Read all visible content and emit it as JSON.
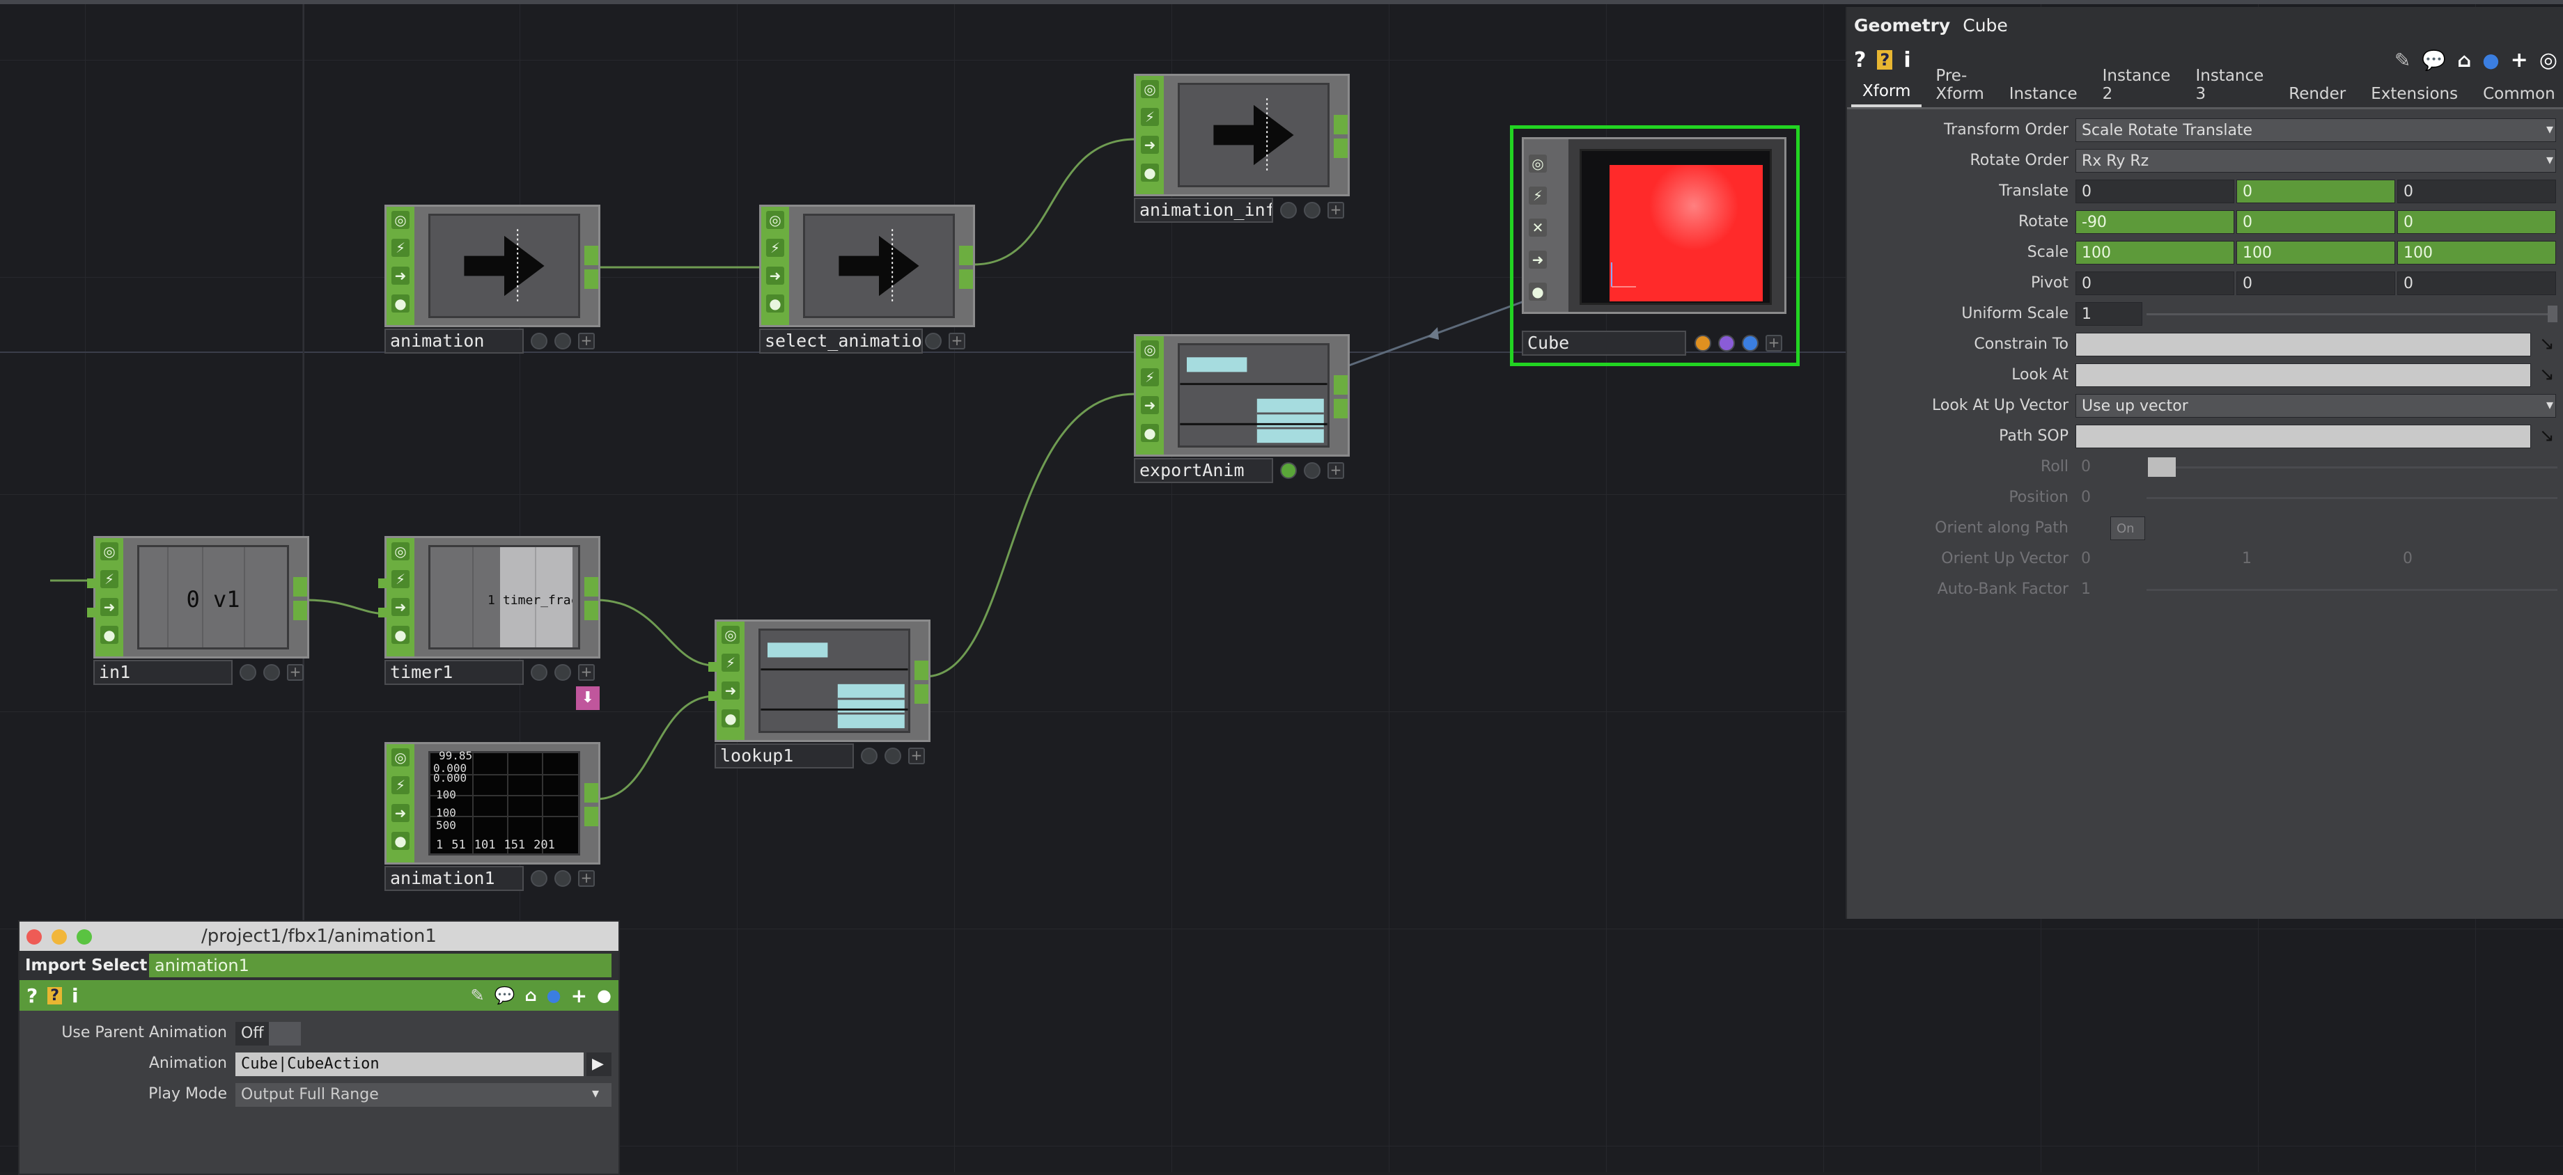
{
  "network": {
    "nodes": {
      "animation": {
        "label": "animation"
      },
      "select_animation": {
        "label": "select_animation"
      },
      "animation_info": {
        "label": "animation_info"
      },
      "exportAnim": {
        "label": "exportAnim"
      },
      "cube": {
        "label": "Cube"
      },
      "in1": {
        "label": "in1",
        "display": "0 v1"
      },
      "timer1": {
        "label": "timer1",
        "display_num": "1",
        "display_chan": "timer_frac"
      },
      "lookup1": {
        "label": "lookup1"
      },
      "animation1": {
        "label": "animation1",
        "values": [
          "99.85",
          "0.000",
          "0.000",
          "100",
          "100",
          "500"
        ],
        "ticks": [
          "1",
          "51",
          "101",
          "151",
          "201"
        ]
      }
    }
  },
  "geometry_panel": {
    "op_type": "Geometry",
    "op_name": "Cube",
    "tabs": [
      "Xform",
      "Pre-Xform",
      "Instance",
      "Instance 2",
      "Instance 3",
      "Render",
      "Extensions",
      "Common"
    ],
    "active_tab": "Xform",
    "params": {
      "transform_order": {
        "label": "Transform Order",
        "value": "Scale Rotate Translate"
      },
      "rotate_order": {
        "label": "Rotate Order",
        "value": "Rx Ry Rz"
      },
      "translate": {
        "label": "Translate",
        "values": [
          "0",
          "0",
          "0"
        ]
      },
      "rotate": {
        "label": "Rotate",
        "values": [
          "-90",
          "0",
          "0"
        ]
      },
      "scale": {
        "label": "Scale",
        "values": [
          "100",
          "100",
          "100"
        ]
      },
      "pivot": {
        "label": "Pivot",
        "values": [
          "0",
          "0",
          "0"
        ]
      },
      "uniform_scale": {
        "label": "Uniform Scale",
        "value": "1"
      },
      "constrain_to": {
        "label": "Constrain To",
        "value": ""
      },
      "look_at": {
        "label": "Look At",
        "value": ""
      },
      "look_at_up_vector": {
        "label": "Look At Up Vector",
        "value": "Use up vector"
      },
      "path_sop": {
        "label": "Path SOP",
        "value": ""
      },
      "roll": {
        "label": "Roll",
        "value": "0"
      },
      "position": {
        "label": "Position",
        "value": "0"
      },
      "orient_along_path": {
        "label": "Orient along Path",
        "value": "On"
      },
      "orient_up_vector": {
        "label": "Orient Up Vector",
        "values": [
          "0",
          "1",
          "0"
        ]
      },
      "auto_bank_factor": {
        "label": "Auto-Bank Factor",
        "value": "1"
      }
    }
  },
  "dialog": {
    "path": "/project1/fbx1/animation1",
    "op_type": "Import Select",
    "op_name": "animation1",
    "params": {
      "use_parent_animation": {
        "label": "Use Parent Animation",
        "value": "Off"
      },
      "animation": {
        "label": "Animation",
        "value": "Cube|CubeAction"
      },
      "play_mode": {
        "label": "Play Mode",
        "value": "Output Full Range"
      }
    }
  },
  "colors": {
    "op_green": "#6cae40",
    "selected_outline": "#22d422",
    "cube_red": "#ff2a2a",
    "wire": "#6f9c52",
    "panel_bg": "#3e3f42"
  },
  "icons": {
    "help": "?",
    "python": "python-icon",
    "info": "i",
    "edit": "pencil-icon",
    "comment": "comment-icon",
    "bookmark": "bookmark-icon",
    "add": "+",
    "viewer": "target-icon"
  }
}
